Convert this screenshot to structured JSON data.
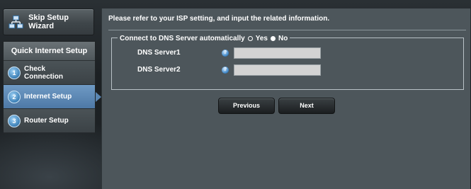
{
  "sidebar": {
    "skip_label": "Skip Setup Wizard",
    "header": "Quick Internet Setup",
    "items": [
      {
        "num": "1",
        "label_line1": "Check",
        "label_line2": "Connection"
      },
      {
        "num": "2",
        "label_line1": "Internet Setup",
        "label_line2": ""
      },
      {
        "num": "3",
        "label_line1": "Router Setup",
        "label_line2": ""
      }
    ],
    "active_index": 1
  },
  "main": {
    "instruction": "Please refer to your ISP setting, and input the related information.",
    "dns_auto": {
      "label": "Connect to DNS Server automatically",
      "option_yes": "Yes",
      "option_no": "No",
      "selected": "No"
    },
    "dns_server1": {
      "label": "DNS Server1",
      "value": ""
    },
    "dns_server2": {
      "label": "DNS Server2",
      "value": ""
    },
    "previous_label": "Previous",
    "next_label": "Next"
  },
  "colors": {
    "panel_bg": "#4d565b",
    "active_item": "#5a86b2"
  },
  "icons": {
    "skip": "network-icon",
    "help": "help-icon"
  }
}
